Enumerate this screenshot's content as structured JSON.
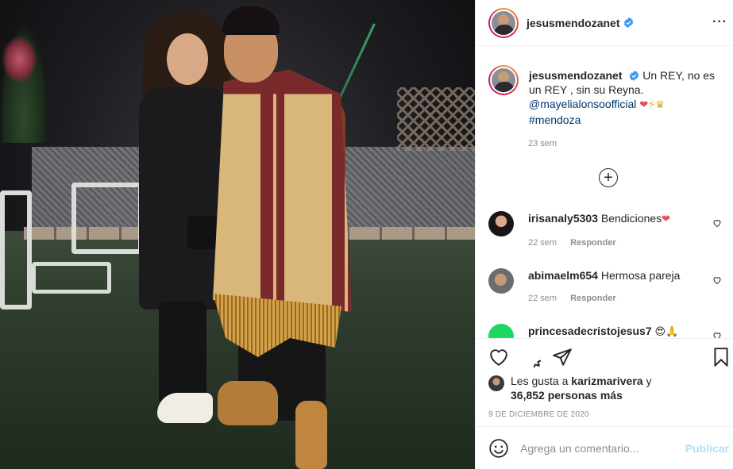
{
  "post": {
    "username": "jesusmendozanet",
    "verified": true,
    "more_icon": "more-horizontal-icon"
  },
  "caption": {
    "username": "jesusmendozanet",
    "text": "Un REY, no es un REY , sin su Reyna.",
    "mention": "@mayelialonsoofficial",
    "emojis": "❤⚡♛",
    "hashtag": "#mendoza",
    "time": "23 sem"
  },
  "load_more": "+",
  "comments": [
    {
      "username": "irisanaly5303",
      "text": "Bendiciones",
      "emoji": "❤",
      "time": "22 sem",
      "reply": "Responder"
    },
    {
      "username": "abimaelm654",
      "text": "Hermosa pareja",
      "emoji": "",
      "time": "22 sem",
      "reply": "Responder"
    },
    {
      "username": "princesadecristojesus7",
      "text": "",
      "emoji": "😍🙏",
      "time": "",
      "reply": ""
    }
  ],
  "likes": {
    "prefix": "Les gusta a",
    "user": "karizmarivera",
    "suffix": "y",
    "count_text": "36,852 personas más"
  },
  "date": "9 DE DICIEMBRE DE 2020",
  "add_comment": {
    "placeholder": "Agrega un comentario...",
    "publish": "Publicar"
  },
  "colors": {
    "verified": "#3897f0",
    "link": "#00376b",
    "publish_disabled": "#b2dffc",
    "heart": "#ed4956"
  }
}
